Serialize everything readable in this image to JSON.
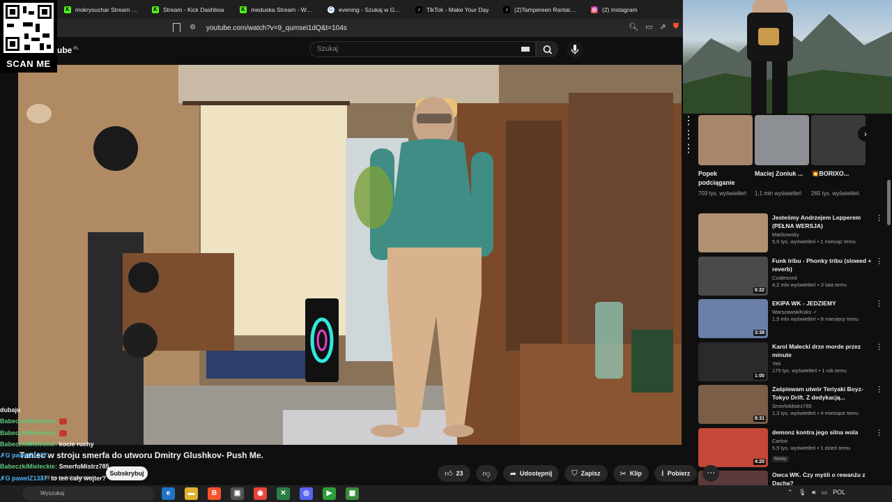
{
  "browser": {
    "tabs": [
      {
        "label": "mokrysuchar Stream - Wat",
        "icon": "kick-icon"
      },
      {
        "label": "Stream - Kick Dashboa",
        "icon": "kick-icon"
      },
      {
        "label": "meduska Stream - Watch L",
        "icon": "kick-icon"
      },
      {
        "label": "evening - Szukaj w Google",
        "icon": "google-icon"
      },
      {
        "label": "TikTok - Make Your Day",
        "icon": "tiktok-icon"
      },
      {
        "label": "(2)Tampereen Rantalejon",
        "icon": "tiktok-icon"
      },
      {
        "label": "(2) Instagram",
        "icon": "instagram-icon"
      }
    ],
    "url": "youtube.com/watch?v=9_qumsei1dQ&t=104s"
  },
  "qr": {
    "label": "SCAN ME"
  },
  "youtube": {
    "logo_text": "ube",
    "logo_region": "PL",
    "search_placeholder": "Szukaj",
    "video_title": "Taniec w stroju smerfa do utworu Dmitry Glushkov- Push Me.",
    "channel_name": "SmerfoMistrz785",
    "subscribers": "1,49 tys. subskrybentów",
    "subscribe_label": "Subskrybuj",
    "likes": "23",
    "share_label": "Udostępnij",
    "save_label": "Zapisz",
    "clip_label": "Klip",
    "download_label": "Pobierz"
  },
  "chat": [
    {
      "user": "",
      "message": "dubaju"
    },
    {
      "user": "BabeczkiMieleckie:",
      "message": "",
      "emote": true
    },
    {
      "user": "BabeczkiMieleckie:",
      "message": "",
      "emote": true
    },
    {
      "user": "BabeczkiMieleckie:",
      "message": "kocie ruchy"
    },
    {
      "user": "✗G pawelZ1337:",
      "message": ""
    },
    {
      "user": "BabeczkiMieleckie:",
      "message": ""
    },
    {
      "user": "✗G pawelZ1337:",
      "message": "to ten cały wojter?"
    },
    {
      "user": "BabeczkiMieleckie:",
      "message": ""
    }
  ],
  "shorts": [
    {
      "title": "Popek podciąganie",
      "views": "703 tys. wyświetleń",
      "color": "#a8866e"
    },
    {
      "title": "Maciej Zoniuk ...",
      "views": "1,1 mln wyświetleń",
      "color": "#8c8f94"
    },
    {
      "title": "💥BORIXO...",
      "views": "265 tys. wyświetleń",
      "color": "#3a3a3a"
    }
  ],
  "recommended": [
    {
      "title": "Jesteśmy Andrzejem Lepperem (PEŁNA WERSJA)",
      "channel": "Maćkowsky",
      "meta": "5,5 tys. wyświetleń • 1 miesiąc temu",
      "duration": "",
      "badge": "",
      "color": "#b09070"
    },
    {
      "title": "Funk tribu - Phonky tribu (slowed + reverb)",
      "channel": "Coalesced",
      "meta": "4,2 mln wyświetleń • 3 lata temu",
      "duration": "6:22",
      "badge": "",
      "color": "#4a4a4a"
    },
    {
      "title": "EKIPA WK - JEDZIEMY",
      "channel": "WarszawskiKoks ✓",
      "meta": "1,5 mln wyświetleń • 8 miesięcy temu",
      "duration": "3:38",
      "badge": "",
      "color": "#6a7fa8"
    },
    {
      "title": "Karol Małecki drze morde przez minute",
      "channel": "Yeti",
      "meta": "175 tys. wyświetleń • 1 rok temu",
      "duration": "1:00",
      "badge": "",
      "color": "#2a2a2a"
    },
    {
      "title": "Zaśpiewam utwór Teriyaki Boyz- Tokyo Drift. Z dedykacją...",
      "channel": "SmerfoMistrz785",
      "meta": "1,3 tys. wyświetleń • 4 miesiące temu",
      "duration": "8:31",
      "badge": "",
      "color": "#7a5e48"
    },
    {
      "title": "demonz kontra jego silna wola",
      "channel": "Carloo",
      "meta": "5,5 tys. wyświetleń • 1 dzień temu",
      "duration": "4:20",
      "badge": "Nowy",
      "color": "#c4473a"
    },
    {
      "title": "Owca WK. Czy myśli o rewanżu z Dachą?",
      "channel": "",
      "meta": "",
      "duration": "",
      "badge": "",
      "color": "#5a3a3a"
    }
  ],
  "taskbar": {
    "search_label": "Wyszukaj",
    "language": "POL"
  }
}
